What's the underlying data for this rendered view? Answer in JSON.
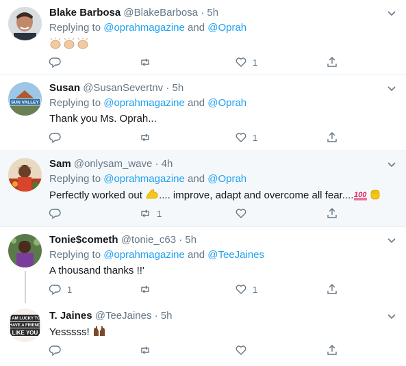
{
  "colors": {
    "link": "#1da1f2",
    "muted": "#657786",
    "border": "#e6ecf0",
    "highlight": "#f5f8fa"
  },
  "tweets": [
    {
      "name": "Blake Barbosa",
      "handle": "@BlakeBarbosa",
      "dot": "·",
      "time": "5h",
      "replying_prefix": "Replying to ",
      "mention1": "@oprahmagazine",
      "and": " and ",
      "mention2": "@Oprah",
      "text": "",
      "emoji": "👏🏼👏🏼👏🏼",
      "replies": "",
      "retweets": "",
      "likes": "1"
    },
    {
      "name": "Susan",
      "handle": "@SusanSevertnv",
      "dot": "·",
      "time": "5h",
      "replying_prefix": "Replying to ",
      "mention1": "@oprahmagazine",
      "and": " and ",
      "mention2": "@Oprah",
      "text": "Thank you Ms. Oprah...",
      "replies": "",
      "retweets": "",
      "likes": "1",
      "avatar_text": "SUN VALLEY"
    },
    {
      "name": "Sam",
      "handle": "@onlysam_wave",
      "dot": "·",
      "time": "4h",
      "replying_prefix": "Replying to ",
      "mention1": "@oprahmagazine",
      "and": " and ",
      "mention2": "@Oprah",
      "text_a": "Perfectly worked out ",
      "text_b": ".... improve, adapt and overcome all fear....",
      "replies": "",
      "retweets": "1",
      "likes": ""
    },
    {
      "name": "Tonie$cometh",
      "handle": "@tonie_c63",
      "dot": "·",
      "time": "5h",
      "replying_prefix": "Replying to ",
      "mention1": "@oprahmagazine",
      "and": " and ",
      "mention2": "@TeeJaines",
      "text": "A thousand thanks !!'",
      "replies": "1",
      "retweets": "",
      "likes": "1"
    },
    {
      "name": "T. Jaines",
      "handle": "@TeeJaines",
      "dot": "·",
      "time": "5h",
      "text": "Yesssss! ",
      "replies": "",
      "retweets": "",
      "likes": "",
      "avatar_lines": [
        "I AM LUCKY TO",
        "HAVE A FRIEND",
        "LIKE YOU"
      ]
    }
  ]
}
